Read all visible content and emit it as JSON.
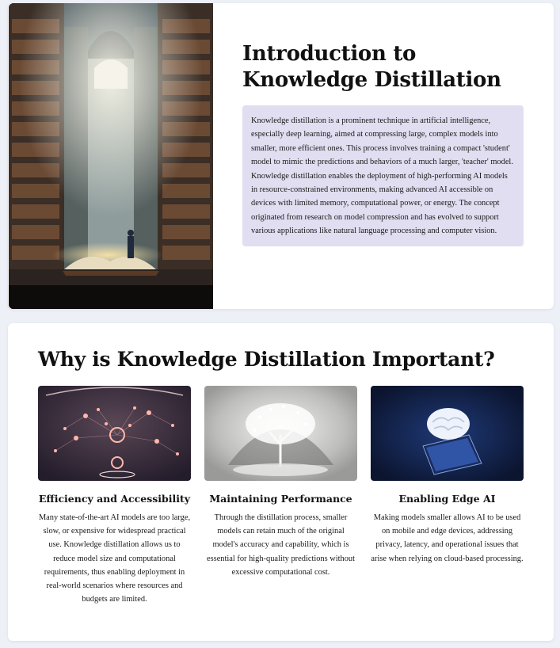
{
  "intro": {
    "title": "Introduction to Knowledge Distillation",
    "body": "Knowledge distillation is a prominent technique in artificial intelligence, especially deep learning, aimed at compressing large, complex models into smaller, more efficient ones. This process involves training a compact 'student' model to mimic the predictions and behaviors of a much larger, 'teacher' model. Knowledge distillation enables the deployment of high-performing AI models in resource-constrained environments, making advanced AI accessible on devices with limited memory, computational power, or energy. The concept originated from research on model compression and has evolved to support various applications like natural language processing and computer vision.",
    "image_icon": "library-book-illustration"
  },
  "why": {
    "title": "Why is Knowledge Distillation Important?",
    "features": [
      {
        "title": "Efficiency and Accessibility",
        "text": "Many state-of-the-art AI models are too large, slow, or expensive for widespread practical use. Knowledge distillation allows us to reduce model size and computational requirements, thus enabling deployment in real-world scenarios where resources and budgets are limited.",
        "image_icon": "neural-network-illustration"
      },
      {
        "title": "Maintaining Performance",
        "text": "Through the distillation process, smaller models can retain much of the original model's accuracy and capability, which is essential for high-quality predictions without excessive computational cost.",
        "image_icon": "glowing-tree-illustration"
      },
      {
        "title": "Enabling Edge AI",
        "text": "Making models smaller allows AI to be used on mobile and edge devices, addressing privacy, latency, and operational issues that arise when relying on cloud-based processing.",
        "image_icon": "brain-on-phone-illustration"
      }
    ]
  },
  "colors": {
    "page_bg": "#eef0f8",
    "card_bg": "#ffffff",
    "intro_box_bg": "#e0def0"
  }
}
